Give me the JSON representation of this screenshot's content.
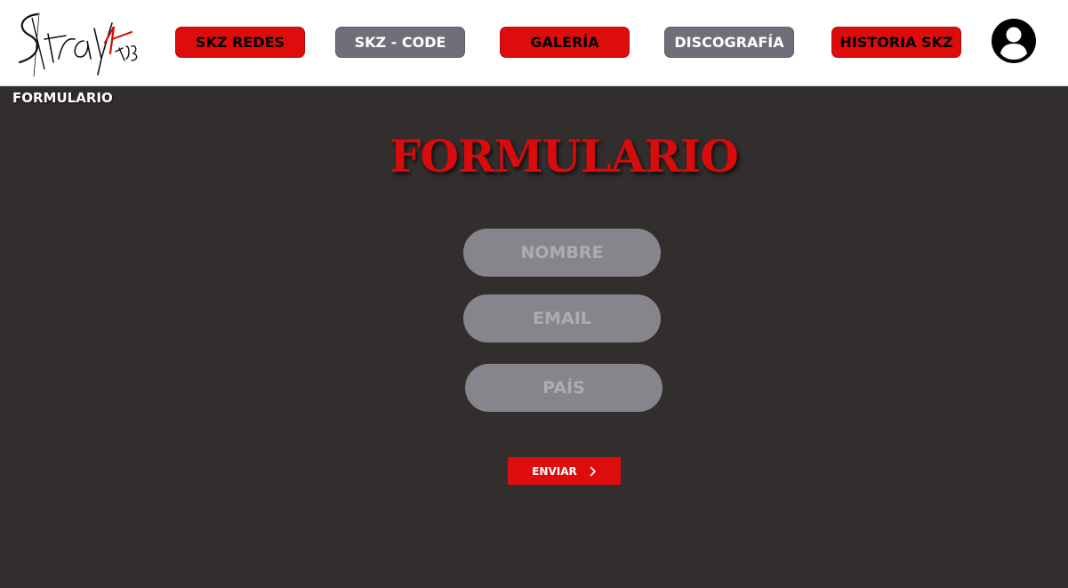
{
  "header": {
    "logo_text": "StrayKids",
    "nav": [
      {
        "label": "SKZ REDES",
        "style": "red"
      },
      {
        "label": "SKZ - CODE",
        "style": "gray"
      },
      {
        "label": "GALERÍA",
        "style": "red"
      },
      {
        "label": "DISCOGRAFÍA",
        "style": "gray"
      },
      {
        "label": "HISTORIA SKZ",
        "style": "red"
      }
    ],
    "user_icon": "user-circle-icon"
  },
  "breadcrumb": "FORMULARIO",
  "form": {
    "title": "FORMULARIO",
    "fields": [
      {
        "placeholder": "NOMBRE",
        "value": ""
      },
      {
        "placeholder": "EMAIL",
        "value": ""
      },
      {
        "placeholder": "PAÍS",
        "value": ""
      }
    ],
    "submit_label": "ENVIAR",
    "submit_icon": "chevron-right-icon"
  },
  "colors": {
    "accent_red": "#dd0d0d",
    "nav_gray": "#6e6f78",
    "background": "#322e2e",
    "field_bg": "#86858c"
  }
}
